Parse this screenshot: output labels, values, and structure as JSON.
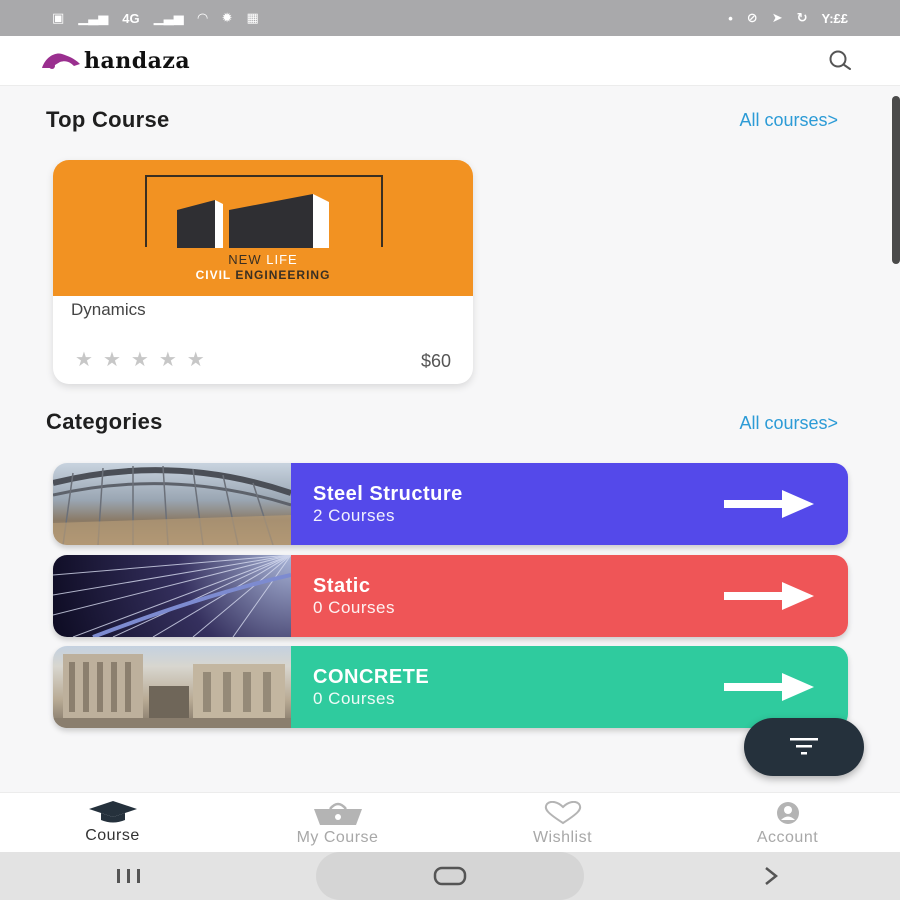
{
  "status_bar": {
    "left_icons": [
      "notification-icon",
      "signal-icon",
      "network-4g-icon",
      "signal-icon",
      "wifi-icon",
      "settings-icon",
      "calendar-icon"
    ],
    "time": "Y:££"
  },
  "app": {
    "logo_text": "handaza",
    "search_icon": "search-icon",
    "brand_color": "#9a2f8f"
  },
  "top_course": {
    "title": "Top Course",
    "link": "All courses>",
    "course": {
      "thumb_line1_a": "NEW",
      "thumb_line1_b": "LIFE",
      "thumb_line2_a": "CIVIL",
      "thumb_line2_b": "ENGINEERING",
      "name": "Dynamics",
      "rating": 0,
      "rating_max": 5,
      "price": "$60",
      "thumb_color": "#f29222"
    }
  },
  "categories": {
    "title": "Categories",
    "link": "All courses>",
    "items": [
      {
        "name": "Steel Structure",
        "count": "2 Courses",
        "color": "#5449ea"
      },
      {
        "name": "Static",
        "count": "0 Courses",
        "color": "#ef5557"
      },
      {
        "name": "CONCRETE",
        "count": "0 Courses",
        "color": "#2fcb9e"
      }
    ]
  },
  "fab": {
    "icon": "filter-icon"
  },
  "bottom_nav": {
    "items": [
      {
        "label": "Course",
        "icon": "graduation-cap-icon",
        "active": true
      },
      {
        "label": "My Course",
        "icon": "shopping-basket-icon",
        "active": false
      },
      {
        "label": "Wishlist",
        "icon": "heart-icon",
        "active": false
      },
      {
        "label": "Account",
        "icon": "user-icon",
        "active": false
      }
    ]
  },
  "system_nav": {
    "recents_icon": "recents-icon",
    "home_icon": "home-icon",
    "back_icon": "back-icon"
  }
}
